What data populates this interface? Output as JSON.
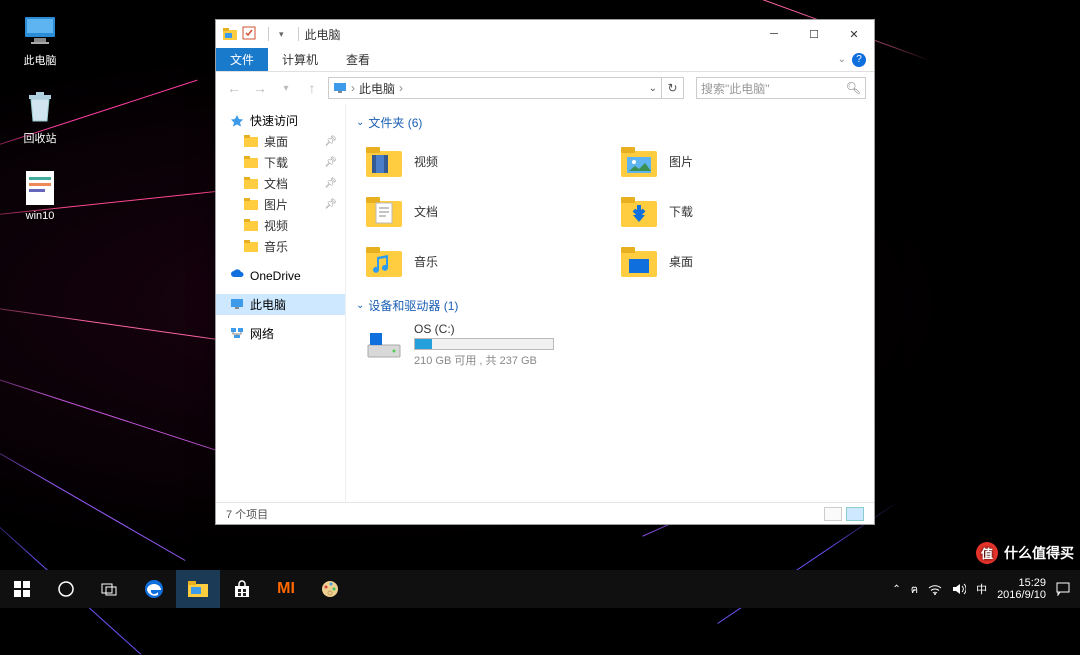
{
  "desktop_icons": {
    "this_pc": "此电脑",
    "recycle_bin": "回收站",
    "win10": "win10"
  },
  "window": {
    "title": "此电脑",
    "tabs": {
      "file": "文件",
      "computer": "计算机",
      "view": "查看"
    },
    "path": {
      "root": "此电脑",
      "dropdown_hint": ""
    },
    "search_placeholder": "搜索\"此电脑\"",
    "nav": {
      "quick": "快速访问",
      "desktop": "桌面",
      "downloads": "下载",
      "documents": "文档",
      "pictures": "图片",
      "videos": "视频",
      "music": "音乐",
      "onedrive": "OneDrive",
      "this_pc": "此电脑",
      "network": "网络"
    },
    "groups": {
      "folders": "文件夹 (6)",
      "devices": "设备和驱动器 (1)"
    },
    "folders": {
      "videos": "视频",
      "pictures": "图片",
      "documents": "文档",
      "downloads": "下载",
      "music": "音乐",
      "desktop": "桌面"
    },
    "drive": {
      "name": "OS (C:)",
      "status": "210 GB 可用 , 共 237 GB",
      "used_pct": 12
    },
    "status": "7 个项目"
  },
  "taskbar": {
    "time": "15:29",
    "date": "2016/9/10",
    "ime": "中"
  },
  "watermark": {
    "text": "什么值得买",
    "badge": "值"
  }
}
